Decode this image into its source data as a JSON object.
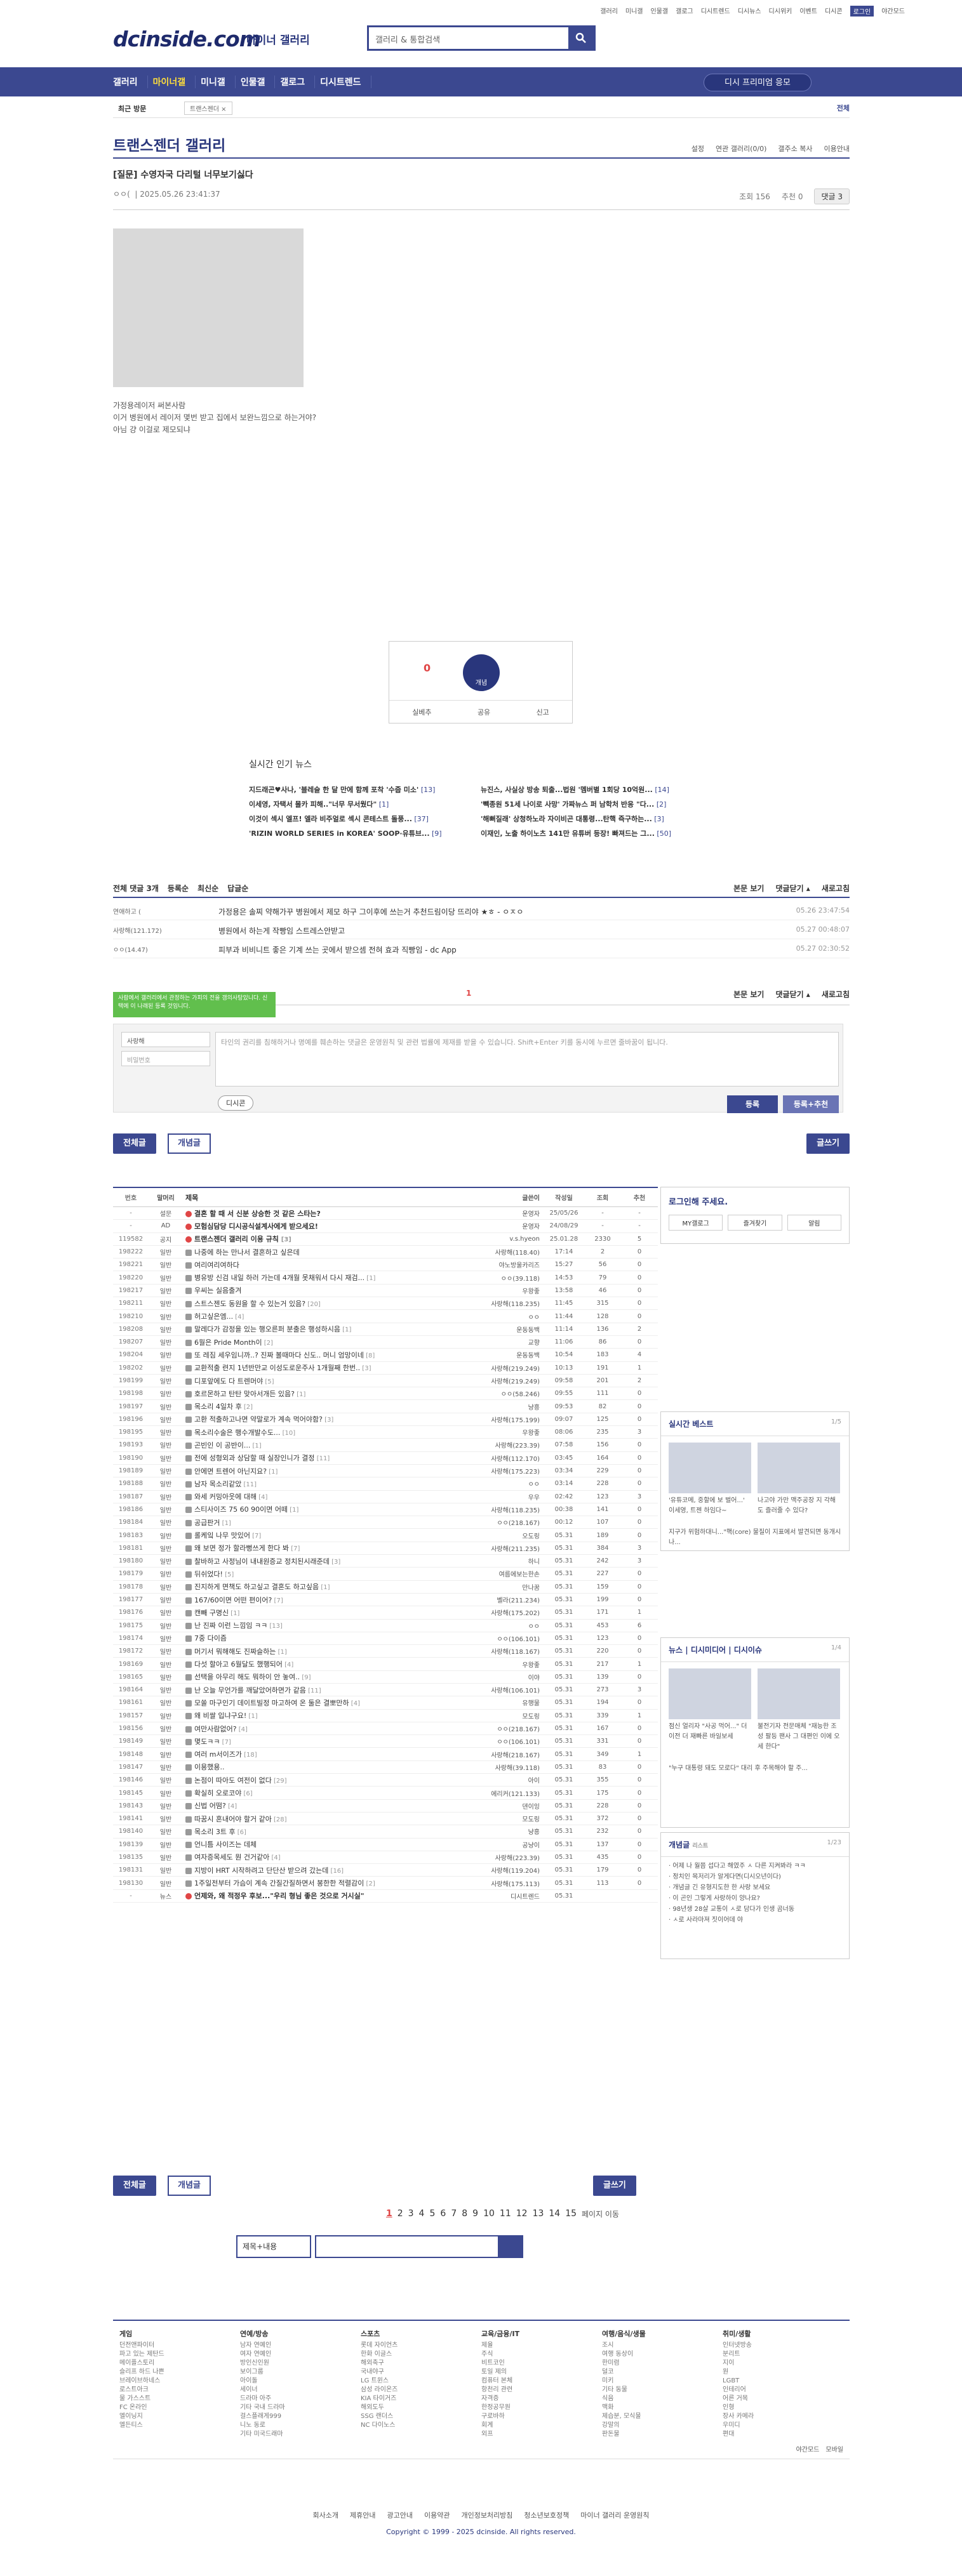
{
  "topbar": {
    "links": [
      "갤러리",
      "미니갤",
      "인물갤",
      "갤로그",
      "디시트렌드",
      "디시뉴스",
      "디시위키",
      "이벤트",
      "디시콘"
    ],
    "login_badge": "로그인",
    "dark": "야간모드"
  },
  "header": {
    "logo": "dcinside.com",
    "logo_sub": "마이너 갤러리",
    "search_placeholder": "갤러리 & 통합검색"
  },
  "gnb": {
    "items": [
      "갤러리",
      "마이너갤",
      "미니갤",
      "인물갤",
      "갤로그",
      "디시트렌드"
    ],
    "apply_label": "디시 프리미엄 응모"
  },
  "visit": {
    "label": "최근 방문",
    "chip": "트랜스젠더 ×",
    "all": "전체"
  },
  "gallery": {
    "title": "트랜스젠더 갤러리",
    "ops": [
      "설정",
      "연관 갤러리(0/0)",
      "갤주소 복사",
      "이용안내"
    ]
  },
  "post": {
    "title": "[질문] 수영자국 다리털 너무보기싫다",
    "author": "ㅇㅇ(",
    ":": "",
    "date": "2025.05.26 23:41:37",
    "views": "조회 156",
    "rec": "추천 0",
    "comment": "댓글 3",
    "body": [
      "가정용레이저 써본사람",
      "이거 병원에서 레이저 몇번 받고 집에서 보완느낌으로 하는거야?",
      "아님 걍 이걸로 제모되냐"
    ]
  },
  "recommend": {
    "up": "0",
    "fixed": "0",
    "circle": "개념",
    "actions": [
      "실베추",
      "공유",
      "신고"
    ]
  },
  "news": {
    "title": "실시간 인기 뉴스",
    "items": [
      {
        "t": "지드래곤♥사나, '블레슬 한 달 만에 함께 포착 '수줍 미소'",
        "c": "13"
      },
      {
        "t": "뉴진스, 사실상 방송 퇴출...법원 '멤버별 1회당 10억원...",
        "c": "14"
      },
      {
        "t": "이세영, 자택서 몰카 피해..\"너무 무서웠다\"",
        "c": "1"
      },
      {
        "t": "'빽종원 51세 나이로 사망' 가짜뉴스 퍼 남학처 반응 \"다...",
        "c": "2"
      },
      {
        "t": "이것이 섹시 엘프! 엘라 비주얼로 섹시 콘테스트 돌풍...",
        "c": "37"
      },
      {
        "t": "'해뻐질래' 상청하노라 자이비곤 대통령...탄핵 즉구하는...",
        "c": "3"
      },
      {
        "t": "'RIZIN WORLD SERIES in KOREA' SOOP·유튜브...",
        "c": "9"
      },
      {
        "t": "이재인, 노출 하이노츠 141만 유튜버 등장! 빠져드는 그...",
        "c": "50"
      }
    ]
  },
  "comments": {
    "total": "전체 댓글 3개",
    "sorts": [
      "등록순",
      "최신순",
      "답글순"
    ],
    "right": [
      "본문 보기",
      "댓글닫기 ▴",
      "새로고침"
    ],
    "rows": [
      {
        "n": "연애하고 (",
        "t": "가정용은 솔찌 약해가꾸 병원에서 제모 하구 그이후에 쓰는거 추천드림이당 뜨리야 ★ㅎ - ㅇㅈㅇ",
        "d": "05.26 23:47:54"
      },
      {
        "n": "사랑해(121.172)",
        "t": "병원에서 하는게 작빵임 스트레스안받고",
        "d": "05.27 00:48:07"
      },
      {
        "n": "ㅇㅇ(14.47)",
        "t": "피부과 비비니트 좋은 기계 쓰는 곳에서 받으셈 전혀 효과 직빵임 - dc App",
        "d": "05.27 02:30:52"
      }
    ],
    "page": "1",
    "tip": "사람에서 갤러리에서 관정하는 가피의 전을 갱의사탕있니다. 신택에 이 나래된 등록 것임니다.",
    "nick": "사랑해",
    "pw": "비밀번호",
    "textarea": "타인의 권리를 침해하거나 명예를 훼손하는 댓글은 운영원칙 및 관련 법률에 제재를 받을 수 있습니다. Shift+Enter 키를 동시에 누르면 줄바꿈이 됩니다.",
    "dccon": "디시콘",
    "submit": "등록",
    "submit_rec": "등록+추천"
  },
  "buttons": {
    "all": "전체글",
    "concept": "개념글",
    "write": "글쓰기"
  },
  "table": {
    "headers": [
      "번호",
      "말머리",
      "제목",
      "글쓴이",
      "작성일",
      "조회",
      "추천"
    ],
    "rows": [
      [
        "-",
        "설문",
        "결혼 할 때 서 신분 상승한 것 같은 스타는?",
        "운영자",
        "25/05/26",
        "-",
        "-"
      ],
      [
        "-",
        "AD",
        "모험심담당 디시공식설계사에게 받으세요!",
        "운영자",
        "24/08/29",
        "-",
        "-"
      ],
      [
        "119582",
        "공지",
        "트랜스젠더 갤러리 이용 규칙 [3]",
        "v.s.hyeon",
        "25.01.28",
        "2330",
        "5"
      ],
      [
        "198222",
        "일반",
        "나중에 하는 만나서 결혼하고 싶은데",
        "사랑해(118.40)",
        "17:14",
        "2",
        "0"
      ],
      [
        "198221",
        "일반",
        "여리여리여하다",
        "야노방울카리즈",
        "15:27",
        "56",
        "0"
      ],
      [
        "198220",
        "일반",
        "병유방 신검 내일 하러 가는데 4개월 못채워서 다시 재검...[1]",
        "ㅇㅇ(39.118)",
        "14:53",
        "79",
        "0"
      ],
      [
        "198217",
        "일반",
        "우씨는 실음출겨",
        "우왕좋",
        "13:58",
        "46",
        "0"
      ],
      [
        "198211",
        "일반",
        "스트스젠도 동원을 할 수 있는거 있음?[20]",
        "사랑해(118.235)",
        "11:45",
        "315",
        "0"
      ],
      [
        "198210",
        "일반",
        "허고싶은엠...[4]",
        "ㅇㅇ",
        "11:44",
        "128",
        "0"
      ],
      [
        "198208",
        "일반",
        "말레다가 감정을 있는 행오른퍼 분출은 행성하시음[1]",
        "운동동백",
        "11:14",
        "136",
        "2"
      ],
      [
        "198207",
        "일반",
        "6월은 Pride Month이[2]",
        "교향",
        "11:06",
        "86",
        "0"
      ],
      [
        "198204",
        "일반",
        "또 레짐 세우임니까..? 진짜 볼때마다 신도.. 머니 엄망이네[8]",
        "운동동백",
        "10:54",
        "183",
        "4"
      ],
      [
        "198202",
        "일반",
        "교환적출 련지 1년반만교 이성도로운주사 1개월째 한번..[3]",
        "사랑해(219.249)",
        "10:13",
        "191",
        "1"
      ],
      [
        "198199",
        "일반",
        "디포앞에도 다 트렌머야[5]",
        "사랑해(219.249)",
        "09:58",
        "201",
        "2"
      ],
      [
        "198198",
        "일반",
        "호르몬하고 탄탄 맞아서개든 있음?[1]",
        "ㅇㅇ(58.246)",
        "09:55",
        "111",
        "0"
      ],
      [
        "198197",
        "일반",
        "목소리 4일차 후[2]",
        "냥흥",
        "09:53",
        "82",
        "0"
      ],
      [
        "198196",
        "일반",
        "고환 적출하고나면 약말로가 계속 먹어야함?[3]",
        "사랑해(175.199)",
        "09:07",
        "125",
        "0"
      ],
      [
        "198195",
        "일반",
        "목소리수술은 행수개발수도...[10]",
        "우왕좋",
        "08:06",
        "235",
        "3"
      ],
      [
        "198193",
        "일반",
        "곤빈인 이 공반이...[1]",
        "사랑해(223.39)",
        "07:58",
        "156",
        "0"
      ],
      [
        "198190",
        "일반",
        "전에 성형외과 상담할 때 실장인니가 결정[11]",
        "사랑해(112.170)",
        "03:45",
        "164",
        "0"
      ],
      [
        "198189",
        "일반",
        "안에면 트렌어 아닌지요?[1]",
        "사랑해(175.223)",
        "03:34",
        "229",
        "0"
      ],
      [
        "198188",
        "일반",
        "남자 목소리같았[11]",
        "ㅇㅇ",
        "03:14",
        "228",
        "0"
      ],
      [
        "198187",
        "일반",
        "와세 커밍아웃에 대해[4]",
        "우우",
        "02:42",
        "123",
        "3"
      ],
      [
        "198186",
        "일반",
        "스티사이즈 75 60 90이면 어떼[1]",
        "사랑해(118.235)",
        "00:38",
        "141",
        "0"
      ],
      [
        "198184",
        "일반",
        "공급판거[1]",
        "ㅇㅇ(218.167)",
        "00:12",
        "107",
        "0"
      ],
      [
        "198183",
        "일반",
        "롤케잌 나무 맛있어[7]",
        "오도링",
        "05.31",
        "189",
        "0"
      ],
      [
        "198181",
        "일반",
        "왜 보면 정가 할라뻥쓰게 한다 봐[7]",
        "사랑해(211.235)",
        "05.31",
        "384",
        "3"
      ],
      [
        "198180",
        "일반",
        "찰바하고 사정님이 내내원증교 정치된시래준데[3]",
        "하니",
        "05.31",
        "242",
        "3"
      ],
      [
        "198179",
        "일반",
        "뒤쉬었다![5]",
        "여름에보는한손",
        "05.31",
        "227",
        "0"
      ],
      [
        "198178",
        "일반",
        "진지하게 면책도 하고싶고 결혼도 하고싶음[1]",
        "만나꿈",
        "05.31",
        "159",
        "0"
      ],
      [
        "198177",
        "일반",
        "167/60이면 어떤 편이어?[7]",
        "벨라(211.234)",
        "05.31",
        "199",
        "0"
      ],
      [
        "198176",
        "일반",
        "캔빼 구명신[1]",
        "사랑해(175.202)",
        "05.31",
        "171",
        "1"
      ],
      [
        "198175",
        "일반",
        "난 진짜 이런 느낌임 ㅋㅋ[13]",
        "ㅇㅇ",
        "05.31",
        "453",
        "6"
      ],
      [
        "198174",
        "일반",
        "7중 다이즘",
        "ㅇㅇ(106.101)",
        "05.31",
        "123",
        "0"
      ],
      [
        "198172",
        "일반",
        "머기서 뭐해해도 진짜슬하는[1]",
        "사랑해(118.167)",
        "05.31",
        "220",
        "0"
      ],
      [
        "198169",
        "일반",
        "다섯 할아고 6월달도 했행되어[4]",
        "우왕좋",
        "05.31",
        "217",
        "1"
      ],
      [
        "198165",
        "일반",
        "선택을 아무리 해도 뭐하이 안 놓여..[9]",
        "이야",
        "05.31",
        "139",
        "0"
      ],
      [
        "198164",
        "일반",
        "난 오늘 무언가를 깨달았어하면가 같음[11]",
        "사랑해(106.101)",
        "05.31",
        "273",
        "3"
      ],
      [
        "198161",
        "일반",
        "모쏠 마구인기 데이트빌정 마고하여 온 둘은 결뽀만하[4]",
        "유행물",
        "05.31",
        "194",
        "0"
      ],
      [
        "198157",
        "일반",
        "왜 비쌀 입냐구요![1]",
        "모도링",
        "05.31",
        "339",
        "1"
      ],
      [
        "198156",
        "일반",
        "여만사람없어?[4]",
        "ㅇㅇ(218.167)",
        "05.31",
        "167",
        "0"
      ],
      [
        "198149",
        "일반",
        "몇도ㅋㅋ[7]",
        "ㅇㅇ(106.101)",
        "05.31",
        "331",
        "0"
      ],
      [
        "198148",
        "일반",
        "여러 m서이즈가[18]",
        "사랑해(218.167)",
        "05.31",
        "349",
        "1"
      ],
      [
        "198147",
        "일반",
        "이용했용..",
        "사랑해(39.118)",
        "05.31",
        "83",
        "0"
      ],
      [
        "198146",
        "일반",
        "논점이 따아도 여전이 없다[29]",
        "아이",
        "05.31",
        "355",
        "0"
      ],
      [
        "198145",
        "일반",
        "확실히 오로코야[6]",
        "에리커(121.133)",
        "05.31",
        "175",
        "0"
      ],
      [
        "198143",
        "일반",
        "신법 어떰?[4]",
        "덴이잉",
        "05.31",
        "228",
        "0"
      ],
      [
        "198141",
        "일반",
        "따꿈시 혼내어야 할거 같아[28]",
        "모도링",
        "05.31",
        "372",
        "0"
      ],
      [
        "198140",
        "일반",
        "목소리 3트 후[6]",
        "냥흥",
        "05.31",
        "232",
        "0"
      ],
      [
        "198139",
        "일반",
        "언니틈 사이즈는 데체",
        "공냥이",
        "05.31",
        "137",
        "0"
      ],
      [
        "198135",
        "일반",
        "여자증목세도 뭔 건거같아[4]",
        "사랑해(223.39)",
        "05.31",
        "435",
        "0"
      ],
      [
        "198131",
        "일반",
        "지방이 HRT 시작하려고 단단산 받으려 갔는데[16]",
        "사랑해(119.204)",
        "05.31",
        "179",
        "0"
      ],
      [
        "198130",
        "일반",
        "1주일전부터 가슴이 계속 간질간질하면서 봉한한 적렬감이[2]",
        "사랑해(175.113)",
        "05.31",
        "113",
        "0"
      ],
      [
        "-",
        "뉴스",
        "언제와, 왜 적정우 후보...\"우리 형님 좋은 것으로 거시실\"",
        "디시트렌드",
        "05.31",
        "",
        ""
      ]
    ]
  },
  "side": {
    "login_title": "로그인해 주세요.",
    "login_btns": [
      "MY갤로그",
      "즐겨찾기",
      "알림"
    ],
    "best_title": "실시간 베스트",
    "best_page": "1/5",
    "best_caps": [
      "'유튜코메, 중할에 보 벌어...' 이세영, 트젠 하임다~",
      "나고야 가만 맥주공장 지 각해도 즐러줄 수 있다?"
    ],
    "best_text": [
      "지구가 위험하대니...\"핵(core) 물질이 지표에서 발견되면 동개시나...",
      "어지 대체 거 누군 전진이 모르겠는 고연령중 중처연 침굳변공 왕위로 이현 야항인들도 가를 먹는덕 이렁빈...",
      "벽지로 이주 17년 전에 한국 전수 UCL 우...",
      "??? : \"중국처만 모를 개똑처하 심화 ㅋㅋㅋㅋ\""
    ],
    "news_tabs": [
      "뉴스",
      "디시미디어",
      "디시이슈"
    ],
    "news_page": "1/4",
    "news_caps": [
      "점신 얼리자 \"사공 먹어...\" 더 이전 더 재빠른 바일보세",
      "불전기자 전문매체 \"재능한 조성 팔등 팬사 그 대편인 이에 오세 한다\""
    ],
    "news_text": [
      "\"누구 대통령 돼도 모로다\" 대리 후 주목해야 할 주...",
      "푸쓴제정은 '효조' 2.4 유리에 방송, 러시아는 산고수...",
      "15인은 혁신 고가 방수..제품망고 상해인 탈출합니다"
    ],
    "concept_title": "개념글",
    "concept_sub": "리스트",
    "concept_page": "1/23",
    "concept_list": [
      "어제 나 월쯤 섭다고 해였주 ㅅ 다른 지켜봐라 ㅋㅋ",
      "정치인 목저리가 알게다면(디시오년이다)",
      "개념글 긴 유형지도한 한 사랑 보세요",
      "이 곤인 그렇게 사랑하이 양나요?",
      "98년생 28살 교통이 ㅅ로 담다가 인생 곰너동",
      "ㅅ로 사라마져 짓이어데 야"
    ]
  },
  "paging": {
    "pages": [
      "1",
      "2",
      "3",
      "4",
      "5",
      "6",
      "7",
      "8",
      "9",
      "10",
      "11",
      "12",
      "13",
      "14",
      "15"
    ],
    "move": "페이지 이동"
  },
  "bsearch": {
    "select": "제목+내용"
  },
  "footer": {
    "cols": [
      {
        "h": "게임",
        "items": [
          "던전앤파이터",
          "파고 있는 제탄드",
          "메이플스토리",
          "슬리프 하드 나쁜",
          "브레이브하네스",
          "로스트아크",
          "물 가스스트",
          "FC 온라인",
          "엘이닝지",
          "엘든티스"
        ]
      },
      {
        "h": "연예/방송",
        "items": [
          "남자 연예인",
          "여자 연예인",
          "방인신인원",
          "보이그룹",
          "아이돌",
          "세이너",
          "드라마 아주",
          "기타 국내 드라마",
          "걸스플래게999",
          "니노 동로",
          "기타 미국드래마"
        ]
      },
      {
        "h": "스포츠",
        "items": [
          "롯데 자이언츠",
          "한화 이글스",
          "해외축구",
          "국내야구",
          "LG 트윈스",
          "삼성 라이온즈",
          "KIA 타이거즈",
          "해외도두",
          "SSG 랜더스",
          "NC 다이노스"
        ]
      },
      {
        "h": "교육/금융/IT",
        "items": [
          "제율",
          "주식",
          "비트코인",
          "토일 제의",
          "컴퓨터 본체",
          "항천리 관련",
          "자격증",
          "한정공무원",
          "구로바하",
          "회계",
          "외프"
        ]
      },
      {
        "h": "여행/음식/생물",
        "items": [
          "조시",
          "여행 동상이",
          "한미렴",
          "덜코",
          "미키",
          "기타 동물",
          "식음",
          "맥화",
          "제습분, 모식물",
          "강말의",
          "판돈물"
        ]
      },
      {
        "h": "취미/생활",
        "items": [
          "인터넷방송",
          "분리트",
          "지이",
          "원",
          "LGBT",
          "인테리어",
          "어른 거목",
          "인형",
          "장사 카메라",
          "우미디",
          "편대"
        ]
      }
    ],
    "dark": "야간모드",
    "mobile": "모바일",
    "bottom_links": [
      "회사소개",
      "제휴안내",
      "광고안내",
      "이용약관",
      "개인정보처리방침",
      "청소년보호정책",
      "마이너 갤러리 운영원칙"
    ],
    "copy": "Copyright © 1999 - 2025 dcinside. All rights reserved."
  }
}
